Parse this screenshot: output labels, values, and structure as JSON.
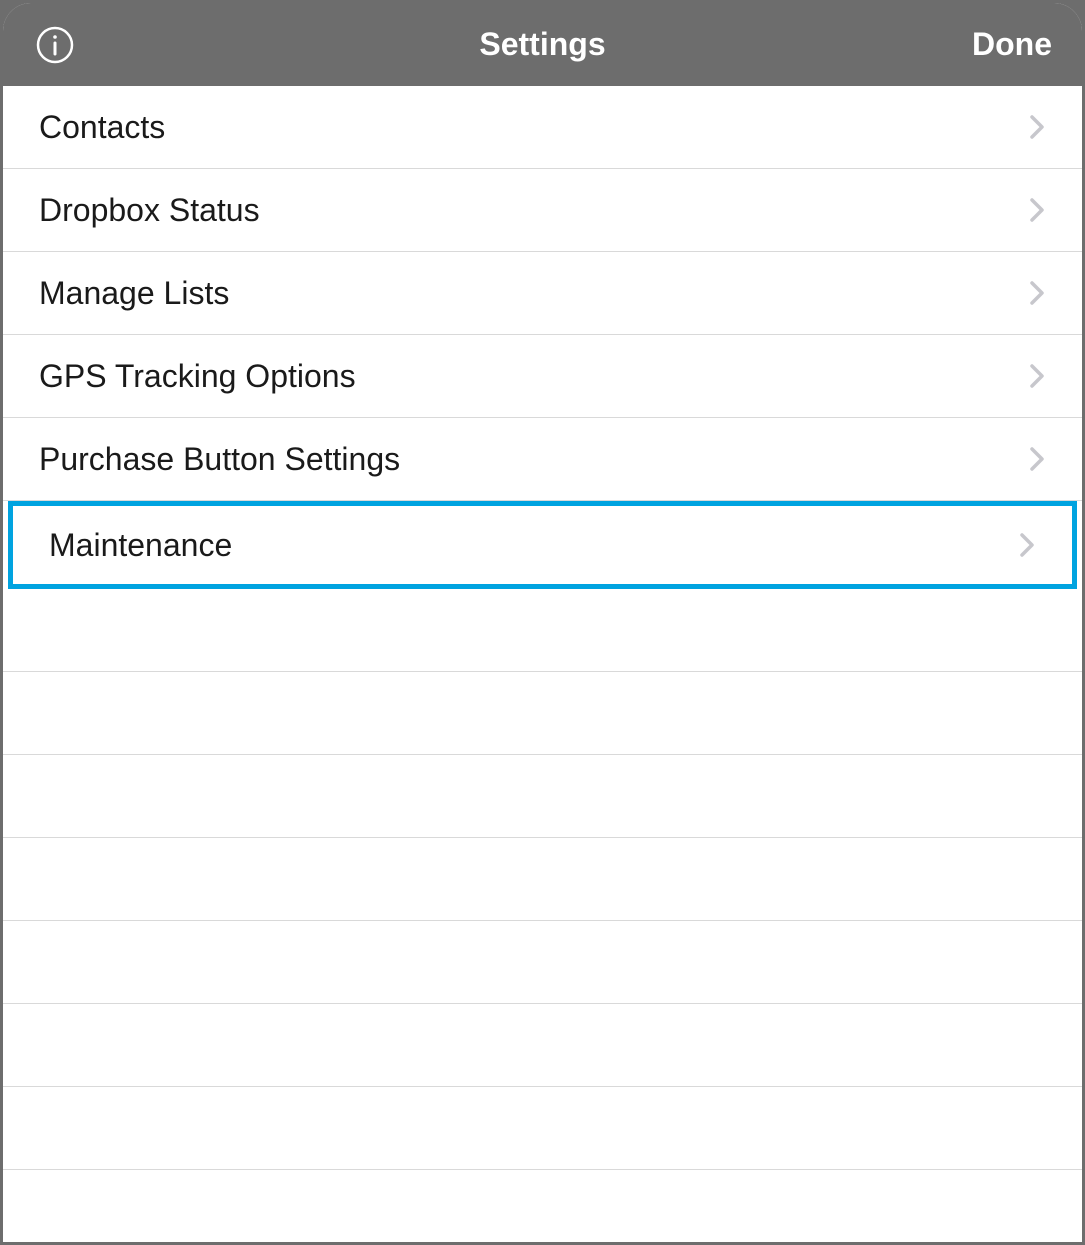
{
  "header": {
    "title": "Settings",
    "done_label": "Done"
  },
  "items": [
    {
      "label": "Contacts",
      "highlighted": false
    },
    {
      "label": "Dropbox Status",
      "highlighted": false
    },
    {
      "label": "Manage Lists",
      "highlighted": false
    },
    {
      "label": "GPS Tracking Options",
      "highlighted": false
    },
    {
      "label": "Purchase Button Settings",
      "highlighted": false
    },
    {
      "label": "Maintenance",
      "highlighted": true
    }
  ],
  "colors": {
    "highlight": "#00a3e0",
    "header_bg": "#6d6d6d",
    "chevron": "#c7c7cc"
  }
}
